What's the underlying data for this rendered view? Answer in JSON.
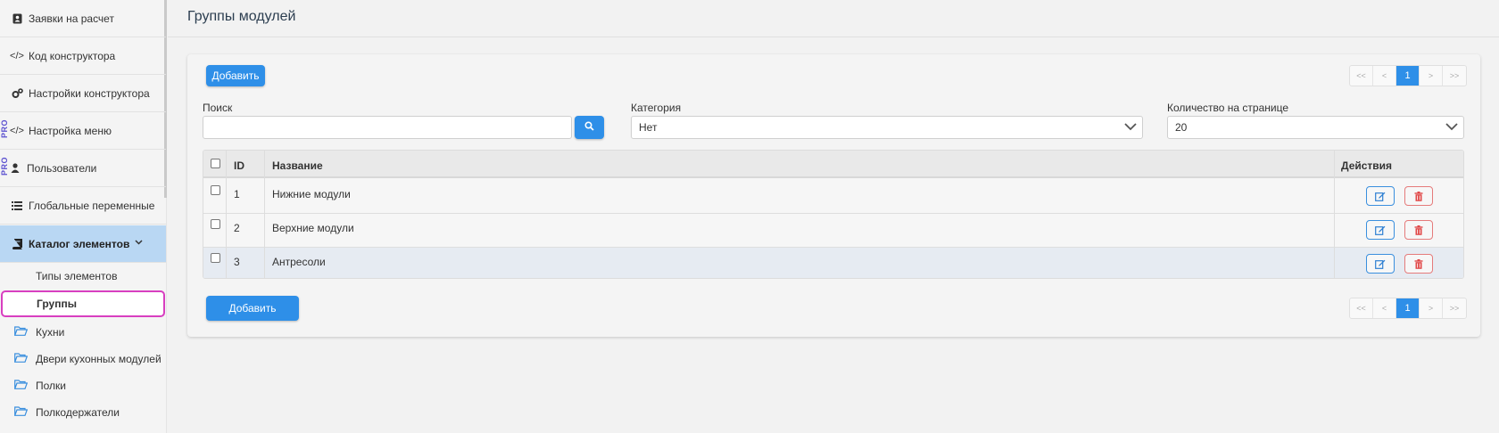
{
  "sidebar": {
    "items": [
      {
        "label": "Заявки на расчет",
        "icon": "address-card-icon"
      },
      {
        "label": "Код конструктора",
        "icon": "code-icon"
      },
      {
        "label": "Настройки конструктора",
        "icon": "cogs-icon"
      },
      {
        "label": "Настройка меню",
        "icon": "code-icon",
        "badge": "PRO"
      },
      {
        "label": "Пользователи",
        "icon": "user-icon",
        "badge": "PRO"
      },
      {
        "label": "Глобальные переменные",
        "icon": "list-icon"
      },
      {
        "label": "Каталог элементов",
        "icon": "book-icon"
      }
    ],
    "subitems": [
      {
        "label": "Типы элементов"
      },
      {
        "label": "Группы"
      }
    ],
    "folders": [
      {
        "label": "Кухни"
      },
      {
        "label": "Двери кухонных модулей"
      },
      {
        "label": "Полки"
      },
      {
        "label": "Полкодержатели"
      }
    ]
  },
  "header": {
    "title": "Группы модулей"
  },
  "toolbar": {
    "add_label": "Добавить",
    "add_bottom_label": "Добавить"
  },
  "pagination": {
    "first": "<<",
    "prev": "<",
    "current": "1",
    "next": ">",
    "last": ">>"
  },
  "filters": {
    "search_label": "Поиск",
    "search_value": "",
    "category_label": "Категория",
    "category_value": "Нет",
    "per_page_label": "Количество на странице",
    "per_page_value": "20"
  },
  "table": {
    "headers": {
      "id": "ID",
      "name": "Название",
      "actions": "Действия"
    },
    "rows": [
      {
        "id": "1",
        "name": "Нижние модули"
      },
      {
        "id": "2",
        "name": "Верхние модули"
      },
      {
        "id": "3",
        "name": "Антресоли"
      }
    ]
  },
  "colors": {
    "accent": "#2e8fe8",
    "active_menu": "#b9d7f3",
    "focus_outline": "#d83fc0",
    "danger": "#e04848"
  }
}
